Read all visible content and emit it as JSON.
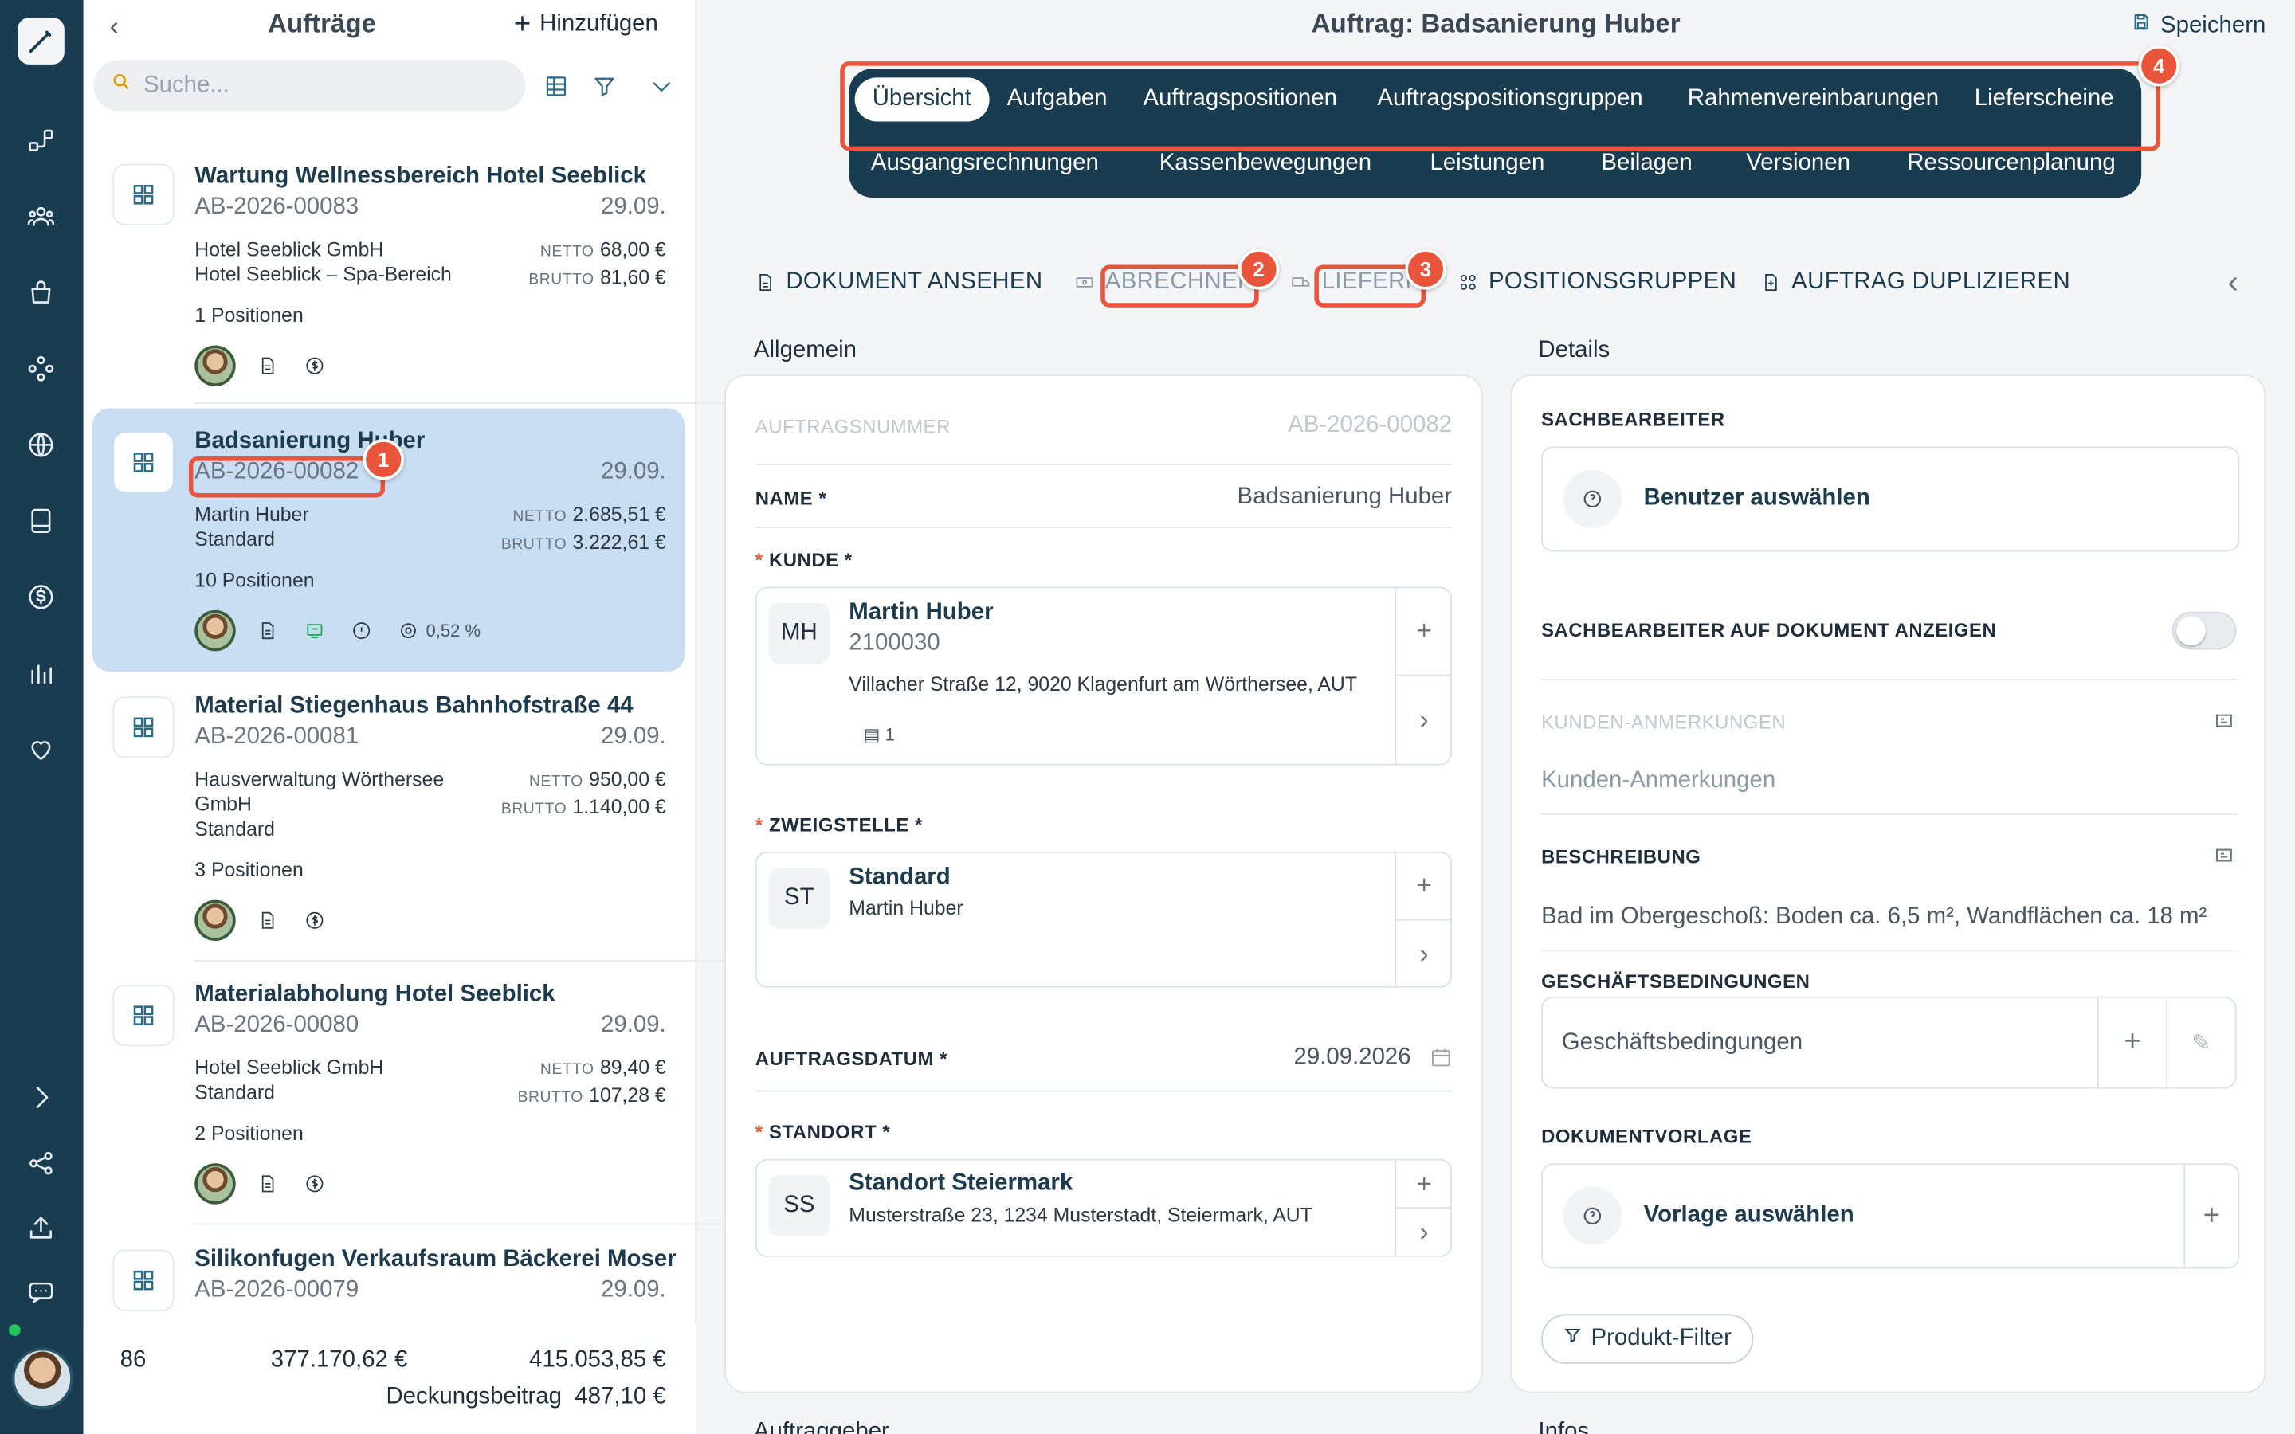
{
  "rail": {
    "icons": [
      "logo-pencil-icon",
      "flow-icon",
      "users-icon",
      "bag-icon",
      "modules-icon",
      "globe-icon",
      "book-icon",
      "dollar-icon",
      "chart-icon",
      "heart-icon",
      "chevron-right-icon",
      "share-icon",
      "upload-icon",
      "chat-icon"
    ]
  },
  "list": {
    "title": "Aufträge",
    "add_label": "Hinzufügen",
    "search_placeholder": "Suche...",
    "cards": [
      {
        "title": "Wartung Wellnessbereich Hotel Seeblick",
        "number": "AB-2026-00083",
        "date": "29.09.",
        "customer": "Hotel Seeblick GmbH",
        "customer2": "Hotel Seeblick – Spa-Bereich",
        "netto_label": "NETTO",
        "netto": "68,00 €",
        "brutto_label": "BRUTTO",
        "brutto": "81,60 €",
        "positions": "1 Positionen"
      },
      {
        "title": "Badsanierung Huber",
        "number": "AB-2026-00082",
        "date": "29.09.",
        "customer": "Martin Huber",
        "customer2": "Standard",
        "netto_label": "NETTO",
        "netto": "2.685,51 €",
        "brutto_label": "BRUTTO",
        "brutto": "3.222,61 €",
        "positions": "10 Positionen",
        "margin": "0,52 %"
      },
      {
        "title": "Material Stiegenhaus Bahnhofstraße 44",
        "number": "AB-2026-00081",
        "date": "29.09.",
        "customer": "Hausverwaltung Wörthersee",
        "customer1b": "GmbH",
        "customer2": "Standard",
        "netto_label": "NETTO",
        "netto": "950,00 €",
        "brutto_label": "BRUTTO",
        "brutto": "1.140,00 €",
        "positions": "3 Positionen"
      },
      {
        "title": "Materialabholung Hotel Seeblick",
        "number": "AB-2026-00080",
        "date": "29.09.",
        "customer": "Hotel Seeblick GmbH",
        "customer2": "Standard",
        "netto_label": "NETTO",
        "netto": "89,40 €",
        "brutto_label": "BRUTTO",
        "brutto": "107,28 €",
        "positions": "2 Positionen"
      },
      {
        "title": "Silikonfugen Verkaufsraum Bäckerei Moser",
        "number": "AB-2026-00079",
        "date": "29.09."
      }
    ],
    "footer": {
      "count": "86",
      "netto_total": "377.170,62 €",
      "brutto_total": "415.053,85 €",
      "db_label": "Deckungsbeitrag",
      "db_value": "487,10 €"
    }
  },
  "main": {
    "title": "Auftrag: Badsanierung Huber",
    "save_label": "Speichern",
    "tabs_row1": [
      "Übersicht",
      "Aufgaben",
      "Auftragspositionen",
      "Auftragspositionsgruppen",
      "Rahmenvereinbarungen",
      "Lieferscheine"
    ],
    "tabs_row2": [
      "Ausgangsrechnungen",
      "Kassenbewegungen",
      "Leistungen",
      "Beilagen",
      "Versionen",
      "Ressourcenplanung"
    ],
    "actions": {
      "view": "DOKUMENT ANSEHEN",
      "bill": "ABRECHNEN",
      "deliver": "LIEFERN",
      "groups": "POSITIONSGRUPPEN",
      "duplicate": "AUFTRAG DUPLIZIEREN"
    },
    "badges": [
      "1",
      "2",
      "3",
      "4"
    ],
    "general": {
      "heading": "Allgemein",
      "order_no_label": "AUFTRAGSNUMMER",
      "order_no": "AB-2026-00082",
      "name_label": "NAME *",
      "name": "Badsanierung Huber",
      "customer_label": "KUNDE *",
      "customer_initials": "MH",
      "customer_name": "Martin Huber",
      "customer_no": "2100030",
      "customer_address": "Villacher Straße 12, 9020 Klagenfurt am Wörthersee, AUT",
      "customer_docs": "1",
      "branch_label": "ZWEIGSTELLE *",
      "branch_initials": "ST",
      "branch_name": "Standard",
      "branch_contact": "Martin Huber",
      "date_label": "AUFTRAGSDATUM *",
      "date": "29.09.2026",
      "site_label": "STANDORT *",
      "site_initials": "SS",
      "site_name": "Standort Steiermark",
      "site_address": "Musterstraße 23, 1234 Musterstadt, Steiermark, AUT"
    },
    "details": {
      "heading": "Details",
      "clerk_label": "SACHBEARBEITER",
      "clerk_placeholder": "Benutzer auswählen",
      "show_clerk_label": "SACHBEARBEITER AUF DOKUMENT ANZEIGEN",
      "remarks_label": "KUNDEN-ANMERKUNGEN",
      "remarks_placeholder": "Kunden-Anmerkungen",
      "desc_label": "BESCHREIBUNG",
      "desc": "Bad im Obergeschoß: Boden ca. 6,5 m², Wandflächen ca. 18 m²",
      "terms_label": "GESCHÄFTSBEDINGUNGEN",
      "terms_placeholder": "Geschäftsbedingungen",
      "template_label": "DOKUMENTVORLAGE",
      "template_placeholder": "Vorlage auswählen",
      "filter_label": "Produkt-Filter"
    },
    "below": {
      "left": "Auftraggeber",
      "right": "Infos"
    }
  },
  "colors": {
    "rail": "#193c50",
    "accent": "#e9553a",
    "selected": "#c9def3"
  }
}
